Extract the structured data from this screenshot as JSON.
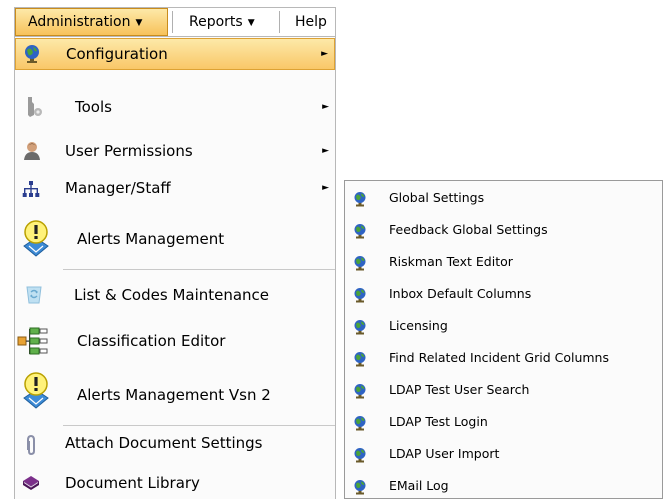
{
  "menubar": {
    "items": [
      {
        "label": "Administration",
        "has_caret": true,
        "active": true
      },
      {
        "label": "Reports",
        "has_caret": true,
        "active": false
      },
      {
        "label": "Help",
        "has_caret": false,
        "active": false
      }
    ]
  },
  "admin_menu": {
    "items": [
      {
        "label": "Configuration",
        "icon": "globe-icon",
        "submenu": true,
        "highlighted": true
      },
      {
        "label": "Tools",
        "icon": "tools-icon",
        "submenu": true
      },
      {
        "label": "User Permissions",
        "icon": "user-icon",
        "submenu": true
      },
      {
        "label": "Manager/Staff",
        "icon": "org-chart-icon",
        "submenu": true
      },
      {
        "label": "Alerts Management",
        "icon": "alert-globe-icon",
        "submenu": false
      },
      {
        "label": "List & Codes Maintenance",
        "icon": "recycle-icon",
        "submenu": false
      },
      {
        "label": "Classification Editor",
        "icon": "classification-tree-icon",
        "submenu": false
      },
      {
        "label": "Alerts Management Vsn 2",
        "icon": "alert-globe-icon",
        "submenu": false
      },
      {
        "label": "Attach Document Settings",
        "icon": "paperclip-icon",
        "submenu": false
      },
      {
        "label": "Document Library",
        "icon": "book-icon",
        "submenu": false
      }
    ]
  },
  "configuration_submenu": {
    "items": [
      {
        "label": "Global Settings",
        "icon": "globe-icon"
      },
      {
        "label": "Feedback Global Settings",
        "icon": "globe-icon"
      },
      {
        "label": "Riskman Text Editor",
        "icon": "globe-icon"
      },
      {
        "label": "Inbox Default Columns",
        "icon": "globe-icon"
      },
      {
        "label": "Licensing",
        "icon": "globe-icon"
      },
      {
        "label": "Find Related Incident Grid Columns",
        "icon": "globe-icon"
      },
      {
        "label": "LDAP Test User Search",
        "icon": "globe-icon"
      },
      {
        "label": "LDAP Test Login",
        "icon": "globe-icon"
      },
      {
        "label": "LDAP User Import",
        "icon": "globe-icon"
      },
      {
        "label": "EMail Log",
        "icon": "globe-icon"
      }
    ]
  },
  "colors": {
    "highlight_top": "#fde9a8",
    "highlight_bottom": "#f9c768",
    "highlight_border": "#dda234"
  }
}
